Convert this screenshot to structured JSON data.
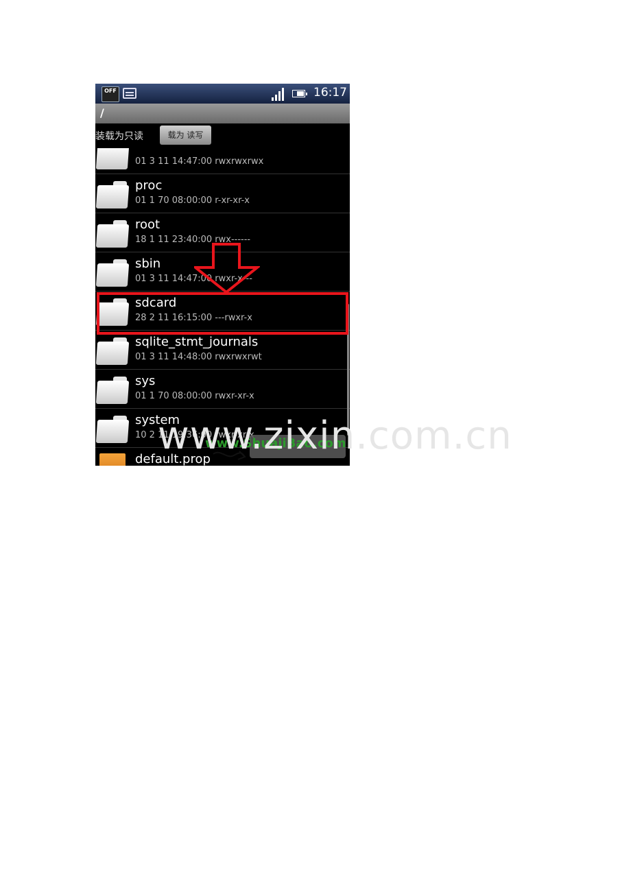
{
  "status_bar": {
    "off_label": "OFF",
    "time": "16:17"
  },
  "path": {
    "current": "/"
  },
  "mount": {
    "label": "装载为只读",
    "button": "载为 读写"
  },
  "files": [
    {
      "name": "...",
      "meta": "01 3 11 14:47:00  rwxrwxrwx",
      "type": "folder"
    },
    {
      "name": "proc",
      "meta": "01 1 70 08:00:00  r-xr-xr-x",
      "type": "folder"
    },
    {
      "name": "root",
      "meta": "18 1 11 23:40:00  rwx------",
      "type": "folder"
    },
    {
      "name": "sbin",
      "meta": "01 3 11 14:47:00  rwxr-x---",
      "type": "folder"
    },
    {
      "name": "sdcard",
      "meta": "28 2 11 16:15:00  ---rwxr-x",
      "type": "folder"
    },
    {
      "name": "sqlite_stmt_journals",
      "meta": "01 3 11 14:48:00  rwxrwxrwt",
      "type": "folder"
    },
    {
      "name": "sys",
      "meta": "01 1 70 08:00:00  rwxr-xr-x",
      "type": "folder"
    },
    {
      "name": "system",
      "meta": "10 2 11 19:36:00  rwxr-xr-x",
      "type": "folder"
    },
    {
      "name": "default.prop",
      "meta": "",
      "type": "file"
    }
  ],
  "watermarks": {
    "phone": "www.ShuajiBao.com",
    "page": "www.zixin.com.cn"
  },
  "colors": {
    "highlight": "#e8151c",
    "status_bar": "#1c2c50",
    "path_bar": "#808080"
  }
}
